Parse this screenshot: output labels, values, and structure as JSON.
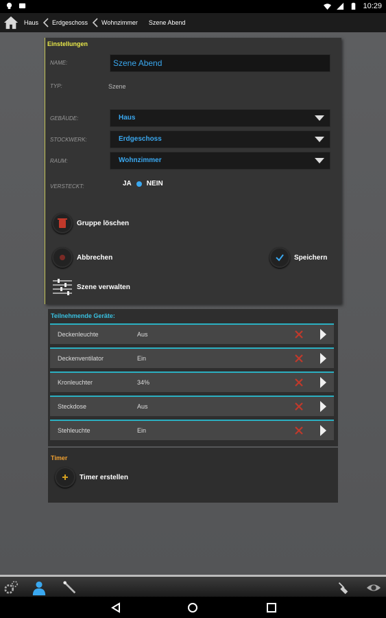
{
  "status_bar": {
    "time": "10:29"
  },
  "breadcrumb": {
    "items": [
      "Haus",
      "Erdgeschoss",
      "Wohnzimmer",
      "Szene Abend"
    ]
  },
  "settings": {
    "title": "Einstellungen",
    "name_label": "NAME:",
    "name_value": "Szene Abend",
    "type_label": "TYP:",
    "type_value": "Szene",
    "building_label": "GEBÄUDE:",
    "building_value": "Haus",
    "floor_label": "STOCKWERK:",
    "floor_value": "Erdgeschoss",
    "room_label": "RAUM:",
    "room_value": "Wohnzimmer",
    "hidden_label": "VERSTECKT:",
    "hidden_yes": "JA",
    "hidden_no": "NEIN",
    "hidden_selected": "NEIN",
    "delete_group": "Gruppe löschen",
    "cancel": "Abbrechen",
    "save": "Speichern",
    "manage_scene": "Szene verwalten"
  },
  "devices": {
    "title": "Teilnehmende Geräte:",
    "rows": [
      {
        "name": "Deckenleuchte",
        "state": "Aus"
      },
      {
        "name": "Deckenventilator",
        "state": "Ein"
      },
      {
        "name": "Kronleuchter",
        "state": "34%"
      },
      {
        "name": "Steckdose",
        "state": "Aus"
      },
      {
        "name": "Stehleuchte",
        "state": "Ein"
      }
    ]
  },
  "timer": {
    "title": "Timer",
    "create": "Timer erstellen"
  },
  "colors": {
    "accent_blue": "#3aa8f0",
    "section_yellow": "#e8e84a",
    "section_orange": "#f0a030",
    "section_cyan": "#39c0e0",
    "delete_red": "#c0392b"
  },
  "icons": {
    "toolbar": [
      "gears-icon",
      "person-icon",
      "magic-wand-icon",
      "broom-icon",
      "eye-icon"
    ]
  }
}
